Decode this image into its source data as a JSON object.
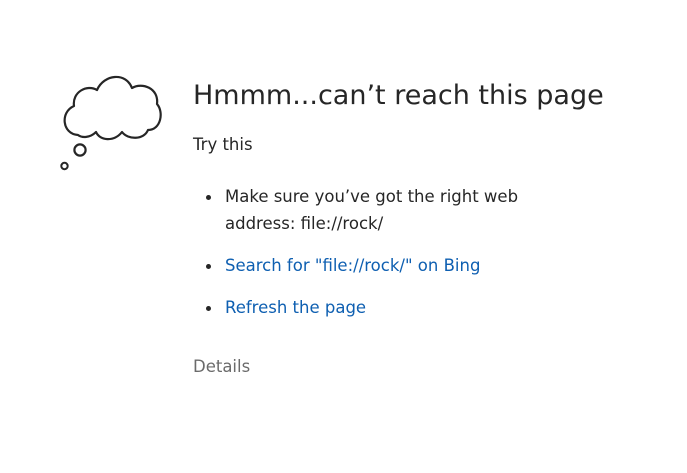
{
  "error": {
    "title": "Hmmm...can’t reach this page",
    "subtitle": "Try this",
    "tips": [
      {
        "text": "Make sure you’ve got the right web address: file://rock/",
        "is_link": false
      },
      {
        "text": "Search for \"file://rock/\" on Bing",
        "is_link": true
      },
      {
        "text": "Refresh the page",
        "is_link": true
      }
    ],
    "details_label": "Details"
  },
  "icons": {
    "illustration": "thought-cloud-icon"
  },
  "colors": {
    "link": "#0e5fb1",
    "text": "#262626",
    "muted": "#6b6b6b",
    "background": "#ffffff"
  }
}
